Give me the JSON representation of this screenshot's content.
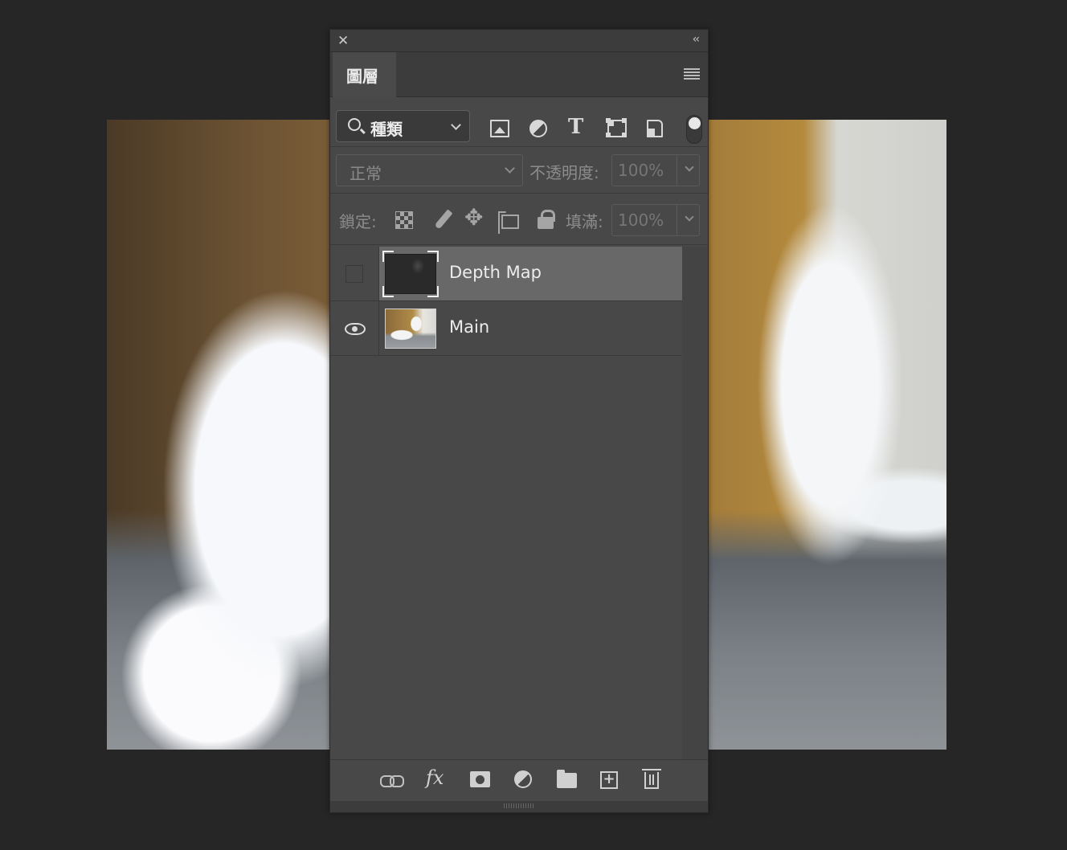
{
  "panel": {
    "tab_label": "圖層",
    "filter": {
      "kind_label": "種類",
      "icons": [
        "image-filter-icon",
        "adjustment-filter-icon",
        "type-filter-icon",
        "shape-filter-icon",
        "smart-object-filter-icon"
      ]
    },
    "blend": {
      "mode": "正常",
      "opacity_label": "不透明度:",
      "opacity_value": "100%"
    },
    "lock": {
      "label": "鎖定:",
      "fill_label": "填滿:",
      "fill_value": "100%"
    },
    "layers": [
      {
        "name": "Depth Map",
        "visible": false,
        "selected": true
      },
      {
        "name": "Main",
        "visible": true,
        "selected": false
      }
    ],
    "bottom_icons": [
      "link-icon",
      "fx-icon",
      "mask-icon",
      "adjustment-layer-icon",
      "group-folder-icon",
      "new-layer-icon",
      "trash-icon"
    ],
    "fx_label": "fx"
  }
}
